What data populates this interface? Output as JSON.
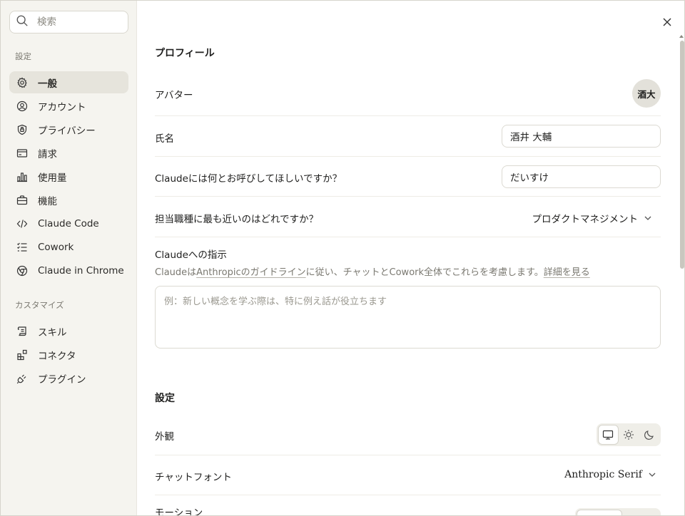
{
  "search": {
    "placeholder": "検索"
  },
  "sidebar": {
    "section_settings": "設定",
    "items": [
      {
        "label": "一般",
        "icon": "gear-icon",
        "active": true
      },
      {
        "label": "アカウント",
        "icon": "user-circle-icon"
      },
      {
        "label": "プライバシー",
        "icon": "shield-lock-icon"
      },
      {
        "label": "請求",
        "icon": "credit-card-icon"
      },
      {
        "label": "使用量",
        "icon": "bar-chart-icon"
      },
      {
        "label": "機能",
        "icon": "briefcase-icon"
      },
      {
        "label": "Claude Code",
        "icon": "code-icon"
      },
      {
        "label": "Cowork",
        "icon": "checklist-icon"
      },
      {
        "label": "Claude in Chrome",
        "icon": "chrome-icon"
      }
    ],
    "section_customize": "カスタマイズ",
    "customize_items": [
      {
        "label": "スキル",
        "icon": "scroll-icon"
      },
      {
        "label": "コネクタ",
        "icon": "connector-icon"
      },
      {
        "label": "プラグイン",
        "icon": "plug-icon"
      }
    ]
  },
  "profile": {
    "heading": "プロフィール",
    "avatar_label": "アバター",
    "avatar_initials": "酒大",
    "name_label": "氏名",
    "name_value": "酒井 大輔",
    "nickname_label": "Claudeには何とお呼びしてほしいですか？",
    "nickname_value": "だいすけ",
    "role_label": "担当職種に最も近いのはどれですか？",
    "role_value": "プロダクトマネジメント",
    "instructions_label": "Claudeへの指示",
    "instructions_sub_1": "Claudeは",
    "instructions_sub_link1": "Anthropicのガイドライン",
    "instructions_sub_2": "に従い、チャットとCowork全体でこれらを考慮します。",
    "instructions_sub_link2": "詳細を見る",
    "instructions_placeholder": "例：新しい概念を学ぶ際は、特に例え話が役立ちます"
  },
  "settings": {
    "heading": "設定",
    "appearance_label": "外観",
    "appearance_options": [
      "monitor-icon",
      "sun-icon",
      "moon-icon"
    ],
    "appearance_selected": "monitor-icon",
    "chat_font_label": "チャットフォント",
    "chat_font_value": "Anthropic Serif",
    "motion_label": "モーション"
  },
  "colors": {
    "sidebar_bg": "#f5f4ef",
    "active_item_bg": "#e6e4dc",
    "text": "#1f1f1e",
    "muted": "#7a7870"
  }
}
